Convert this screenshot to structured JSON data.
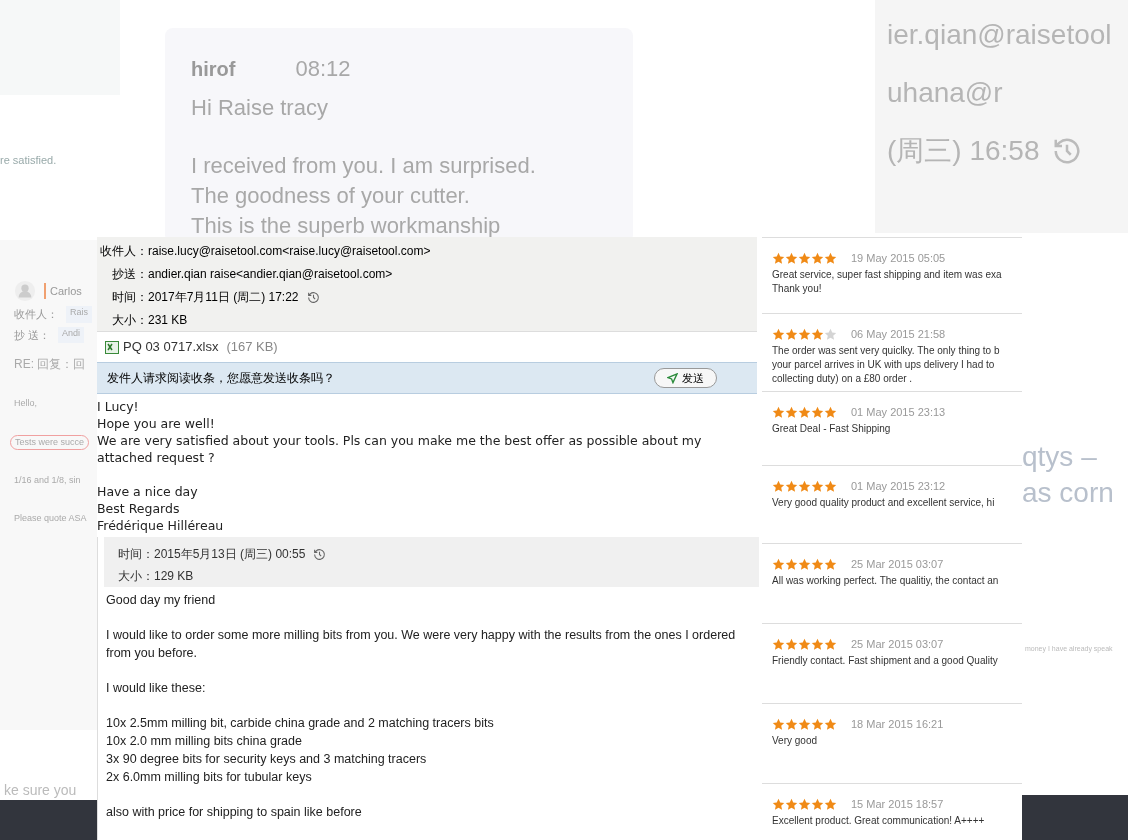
{
  "chat": {
    "sender": "hirof",
    "time": "08:12",
    "lines": [
      "Hi Raise tracy",
      "I received from you. I am surprised.",
      "The goodness of your cutter.",
      "This is the superb workmanship"
    ]
  },
  "header_fragment": {
    "lines": [
      "ier.qian@raisetool",
      "uhana@r",
      "(周三) 16:58"
    ]
  },
  "left_fragment": {
    "top_text": "re satisfied.",
    "sender": "Carlos",
    "fields": [
      {
        "label": "收件人：",
        "value": "Rais"
      },
      {
        "label": "抄 送：",
        "value": "Andi"
      }
    ],
    "subject": "RE: 回复：回",
    "lines": [
      "Hello,",
      "Tests were succe",
      "1/16 and 1/8, sin",
      "Please quote ASA"
    ],
    "bottom_text": "ke sure you"
  },
  "email_1": {
    "fields": [
      "收件人：raise.lucy@raisetool.com<raise.lucy@raisetool.com>",
      "抄送：andier.qian raise<andier.qian@raisetool.com>",
      "时间：2017年7月11日 (周二) 17:22",
      "大小：231 KB"
    ],
    "attachment": {
      "name": "PQ 03 0717.xlsx",
      "size": "(167 KB)"
    },
    "receipt_prompt": "发件人请求阅读收条，您愿意发送收条吗？",
    "send_button": "发送",
    "body": [
      [
        "I Lucy!",
        "Hope you are well!",
        "We are very satisfied about your tools. Pls can you make me the best offer as possible about my attached request ?"
      ],
      [
        "Have a nice day",
        "Best Regards",
        "Frédérique Hilléreau"
      ]
    ]
  },
  "email_2": {
    "fields": [
      "时间：2015年5月13日 (周三) 00:55",
      "大小：129 KB"
    ],
    "body": [
      [
        "Good day my friend"
      ],
      [
        "I would like to order some more milling bits from you. We were very happy with the results from the ones I ordered from you before."
      ],
      [
        "I would like these:"
      ],
      [
        "10x 2.5mm milling bit, carbide china grade and 2 matching tracers bits",
        "10x 2.0 mm milling bits china grade",
        "3x 90 degree bits for security keys and 3 matching tracers",
        "2x 6.0mm milling bits for tubular keys"
      ],
      [
        "also with price for shipping to spain like before"
      ]
    ]
  },
  "reviews": [
    {
      "stars": 5,
      "date": "19 May 2015 05:05",
      "text": [
        "Great service, super fast shipping and item was exa",
        "Thank you!"
      ]
    },
    {
      "stars": 4,
      "date": "06 May 2015 21:58",
      "text": [
        "The order was sent very quiclky. The only thing to b",
        "your parcel arrives in UK with ups delivery I had to",
        "collecting duty) on a £80 order ."
      ]
    },
    {
      "stars": 5,
      "date": "01 May 2015 23:13",
      "text": [
        "Great Deal - Fast Shipping"
      ]
    },
    {
      "stars": 5,
      "date": "01 May 2015 23:12",
      "text": [
        "Very good quality product and excellent service, hi"
      ]
    },
    {
      "stars": 5,
      "date": "25 Mar 2015 03:07",
      "text": [
        "All was working perfect. The qualitiy, the contact an"
      ]
    },
    {
      "stars": 5,
      "date": "25 Mar 2015 03:07",
      "text": [
        "Friendly contact. Fast shipment and a good Quality"
      ]
    },
    {
      "stars": 5,
      "date": "18 Mar 2015 16:21",
      "text": [
        "Very good"
      ]
    },
    {
      "stars": 5,
      "date": "15 Mar 2015 18:57",
      "text": [
        "Excellent product. Great communication! A++++"
      ]
    }
  ],
  "right_fragment": {
    "lines": [
      "qtys –",
      "as corn"
    ],
    "note": "money I have already speak"
  }
}
